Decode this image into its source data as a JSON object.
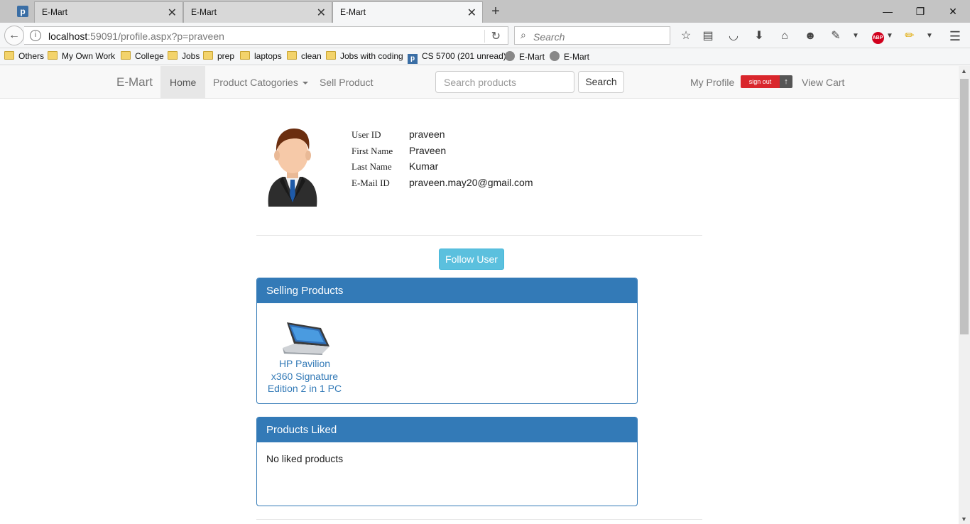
{
  "browser": {
    "tabs": [
      {
        "title": "E-Mart",
        "active": false
      },
      {
        "title": "E-Mart",
        "active": false
      },
      {
        "title": "E-Mart",
        "active": true
      }
    ],
    "url_host": "localhost",
    "url_rest": ":59091/profile.aspx?p=praveen",
    "search_placeholder": "Search",
    "bookmarks": [
      {
        "label": "Others",
        "icon": "folder-icon"
      },
      {
        "label": "My Own Work",
        "icon": "folder-icon"
      },
      {
        "label": "College",
        "icon": "folder-icon"
      },
      {
        "label": "Jobs",
        "icon": "folder-icon"
      },
      {
        "label": "prep",
        "icon": "folder-icon"
      },
      {
        "label": "laptops",
        "icon": "folder-icon"
      },
      {
        "label": "clean",
        "icon": "folder-icon"
      },
      {
        "label": "Jobs with coding",
        "icon": "folder-icon"
      },
      {
        "label": "CS 5700 (201 unread)",
        "icon": "p-favicon"
      },
      {
        "label": "E-Mart",
        "icon": "globe-icon"
      },
      {
        "label": "E-Mart",
        "icon": "globe-icon"
      }
    ]
  },
  "site": {
    "brand": "E-Mart",
    "nav": {
      "home": "Home",
      "categories": "Product Catogories",
      "sell": "Sell Product",
      "search_placeholder": "Search products",
      "search_button": "Search",
      "my_profile": "My Profile",
      "sign_out": "sign out",
      "view_cart": "View Cart"
    },
    "profile": {
      "fields": [
        {
          "label": "User ID",
          "value": "praveen"
        },
        {
          "label": "First Name",
          "value": "Praveen"
        },
        {
          "label": "Last Name",
          "value": "Kumar"
        },
        {
          "label": "E-Mail ID",
          "value": "praveen.may20@gmail.com"
        }
      ],
      "follow_button": "Follow User"
    },
    "selling_panel": {
      "title": "Selling Products",
      "products": [
        {
          "name": "HP Pavilion x360 Signature Edition 2 in 1 PC"
        }
      ]
    },
    "liked_panel": {
      "title": "Products Liked",
      "empty_message": "No liked products"
    }
  },
  "colors": {
    "panel_primary": "#337ab7",
    "follow_button": "#5bc0de",
    "sign_out": "#d9262c"
  }
}
